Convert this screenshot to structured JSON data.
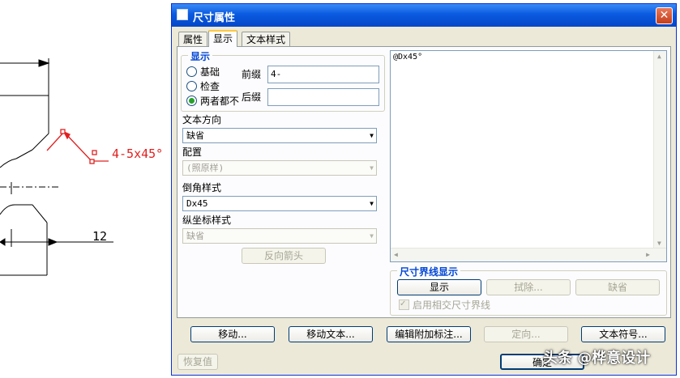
{
  "cad": {
    "chamfer_note": "4-5x45°",
    "dimension_value": "12"
  },
  "dialog": {
    "title": "尺寸属性",
    "tabs": [
      {
        "label": "属性"
      },
      {
        "label": "显示",
        "active": true
      },
      {
        "label": "文本样式"
      }
    ],
    "display_group": {
      "legend": "显示",
      "radios": [
        {
          "label": "基础",
          "checked": false
        },
        {
          "label": "检查",
          "checked": false
        },
        {
          "label": "两者都不",
          "checked": true
        }
      ],
      "prefix_label": "前缀",
      "prefix_value": "4-",
      "suffix_label": "后缀",
      "suffix_value": ""
    },
    "text_direction": {
      "label": "文本方向",
      "value": "缺省"
    },
    "configuration": {
      "label": "配置",
      "value": "(照原样)"
    },
    "chamfer_style": {
      "label": "倒角样式",
      "value": "Dx45"
    },
    "ordinate_style": {
      "label": "纵坐标样式",
      "value": "缺省"
    },
    "reverse_arrow_button": "反向箭头",
    "text_editor_value": "@Dx45°",
    "witness_group": {
      "legend": "尺寸界线显示",
      "show_button": "显示",
      "erase_button": "拭除...",
      "default_button": "缺省",
      "intersect_checkbox": "启用相交尺寸界线"
    },
    "bottom_buttons": {
      "move": "移动...",
      "move_text": "移动文本...",
      "edit_attached_note": "编辑附加标注...",
      "orient": "定向...",
      "text_symbol": "文本符号..."
    },
    "restore_button": "恢复值",
    "ok_button": "确定"
  },
  "watermark": "头条 @桦意设计",
  "colors": {
    "titlebar": "#0a5ae0",
    "cad_highlight": "#e02020",
    "accent_legend": "#0046d5"
  }
}
